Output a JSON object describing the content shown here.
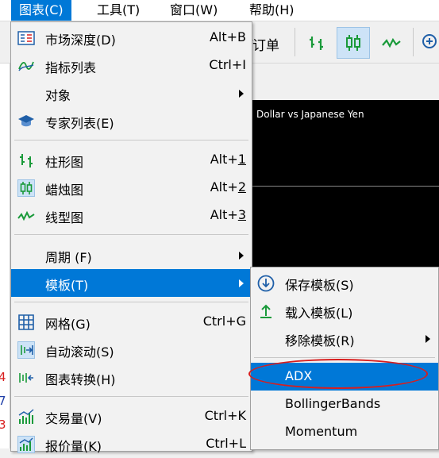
{
  "menubar": {
    "items": [
      {
        "label": "图表(C)"
      },
      {
        "label": "工具(T)"
      },
      {
        "label": "窗口(W)"
      },
      {
        "label": "帮助(H)"
      }
    ]
  },
  "toolbar": {
    "order_text": "f订单"
  },
  "chart": {
    "title": "Dollar vs Japanese Yen"
  },
  "chart_menu": {
    "market_depth": {
      "label": "市场深度(D)",
      "shortcut": "Alt+B",
      "icon": "market-depth-icon"
    },
    "indicators_list": {
      "label": "指标列表",
      "shortcut": "Ctrl+I",
      "icon": "indicators-icon"
    },
    "objects": {
      "label": "对象"
    },
    "experts_list": {
      "label": "专家列表(E)",
      "icon": "graduation-cap-icon"
    },
    "bar_chart": {
      "label": "柱形图",
      "shortcut_prefix": "Alt+",
      "shortcut_key": "1"
    },
    "candle_chart": {
      "label": "蜡烛图",
      "shortcut_prefix": "Alt+",
      "shortcut_key": "2"
    },
    "line_chart": {
      "label": "线型图",
      "shortcut_prefix": "Alt+",
      "shortcut_key": "3"
    },
    "period": {
      "label": "周期 (F)"
    },
    "template": {
      "label": "模板(T)"
    },
    "grid": {
      "label": "网格(G)",
      "shortcut": "Ctrl+G"
    },
    "auto_scroll": {
      "label": "自动滚动(S)"
    },
    "chart_shift": {
      "label": "图表转换(H)"
    },
    "volumes": {
      "label": "交易量(V)",
      "shortcut": "Ctrl+K"
    },
    "tick_volumes": {
      "label": "报价量(K)",
      "shortcut": "Ctrl+L"
    }
  },
  "template_menu": {
    "save": {
      "label": "保存模板(S)"
    },
    "load": {
      "label": "载入模板(L)"
    },
    "remove": {
      "label": "移除模板(R)"
    },
    "templates": [
      {
        "label": "ADX"
      },
      {
        "label": "BollingerBands"
      },
      {
        "label": "Momentum"
      }
    ]
  },
  "colors": {
    "highlight": "#0078d7",
    "icon_green": "#1a9a3a",
    "annotation_red": "#d81e1e"
  }
}
